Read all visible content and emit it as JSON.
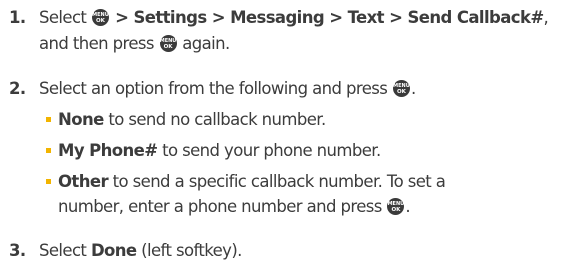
{
  "icons": {
    "menu_key": {
      "name": "menu-ok-key-icon",
      "top": "MENU",
      "bottom": "OK"
    }
  },
  "colors": {
    "text": "#3c3c3c",
    "bullet": "#f2b400",
    "key": "#3a3a3a"
  },
  "steps": [
    {
      "number": "1.",
      "line1": {
        "pre": "Select ",
        "path": " > Settings > Messaging > Text > Send Callback#",
        "post": ","
      },
      "line2": {
        "pre": "and then press ",
        "post": " again."
      }
    },
    {
      "number": "2.",
      "line1": {
        "pre": "Select an option from the following and press ",
        "post": "."
      },
      "options": [
        {
          "bold": "None",
          "text": " to send no callback number."
        },
        {
          "bold": "My Phone#",
          "text": " to send your phone number."
        },
        {
          "bold": "Other",
          "text": " to send a specific callback number. To set a",
          "line2_pre": "number, enter a phone number and press ",
          "line2_post": "."
        }
      ]
    },
    {
      "number": "3.",
      "line1": {
        "pre": "Select ",
        "bold": "Done",
        "post": " (left softkey)."
      }
    }
  ]
}
